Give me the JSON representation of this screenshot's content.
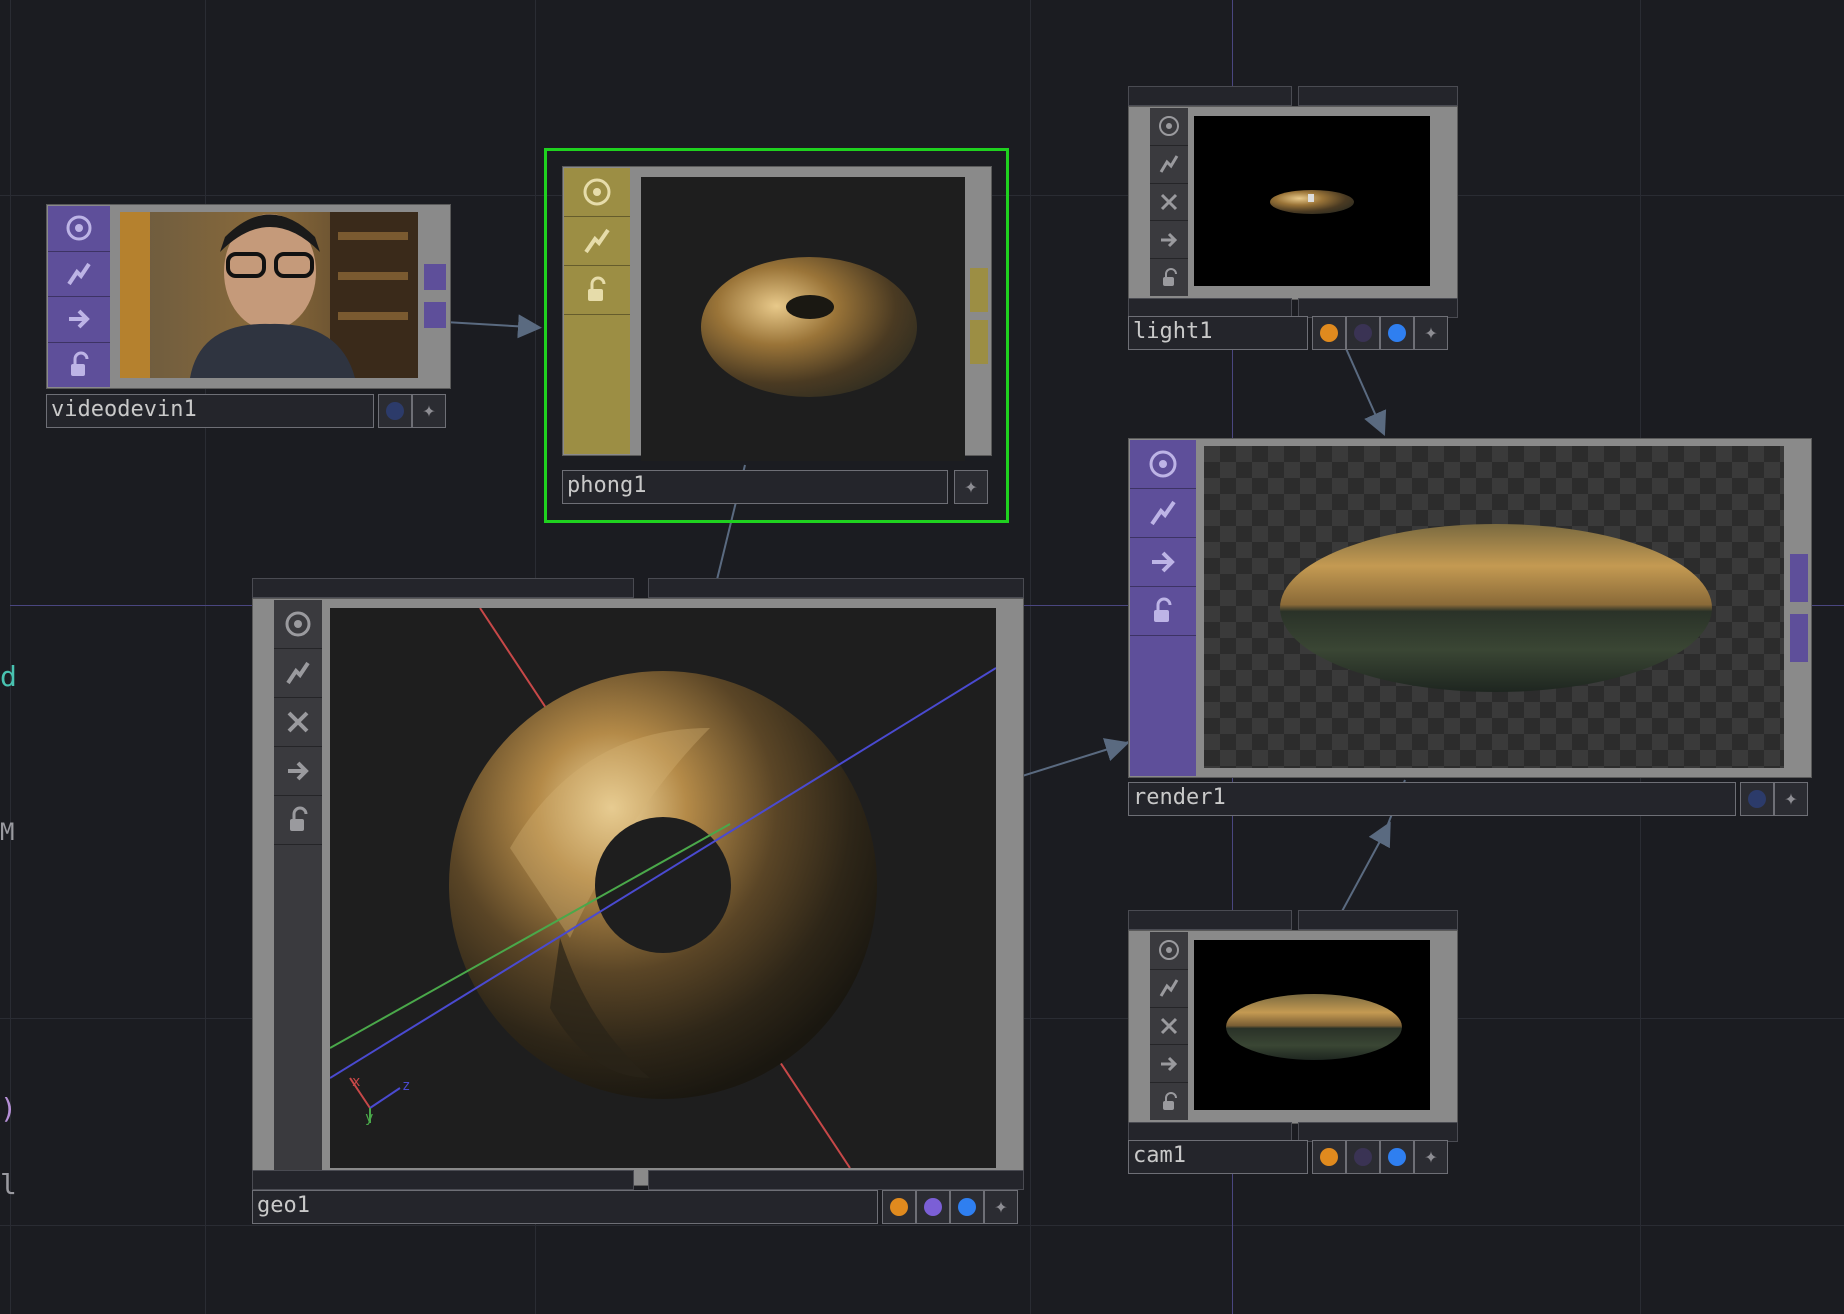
{
  "canvas": {
    "background": "#1b1c21"
  },
  "edge_glyphs": [
    {
      "text": "d",
      "color": "#48c2b0"
    },
    {
      "text": "M",
      "color": "#9a9aa0"
    },
    {
      "text": ")",
      "color": "#b58fd6"
    },
    {
      "text": "l",
      "color": "#9a9aa0"
    }
  ],
  "nodes": {
    "videodevin1": {
      "label": "videodevin1",
      "sidebar_color": "#5e4f9a",
      "badges": [
        "dot-dark-blue",
        "plus-icon"
      ]
    },
    "phong1": {
      "label": "phong1",
      "sidebar_color": "#9c8e44",
      "selected": true,
      "badges": [
        "plus-icon"
      ]
    },
    "light1": {
      "label": "light1",
      "badges": [
        "dot-orange",
        "dot-purple-dark",
        "dot-blue",
        "plus-icon"
      ]
    },
    "render1": {
      "label": "render1",
      "sidebar_color": "#5e4f9a",
      "badges": [
        "dot-dark-blue",
        "plus-icon"
      ]
    },
    "geo1": {
      "label": "geo1",
      "badges": [
        "dot-orange",
        "dot-purple",
        "dot-blue",
        "plus-icon"
      ],
      "axis_labels": {
        "x": "x",
        "y": "y",
        "z": "z"
      }
    },
    "cam1": {
      "label": "cam1",
      "badges": [
        "dot-orange",
        "dot-purple-dark",
        "dot-blue",
        "plus-icon"
      ]
    }
  },
  "icons": {
    "viewer": "target-icon",
    "bypass": "lightning-icon",
    "cook": "x-icon",
    "export": "arrow-right-icon",
    "lock": "lock-icon"
  },
  "colors": {
    "selection": "#1fd11f",
    "dot_orange": "#e08a1e",
    "dot_purple": "#7b5fd6",
    "dot_purple_dark": "#3a3354",
    "dot_blue": "#2f7ff0",
    "dot_dark_blue": "#2c3b6a",
    "wire": "#5a6a80"
  }
}
